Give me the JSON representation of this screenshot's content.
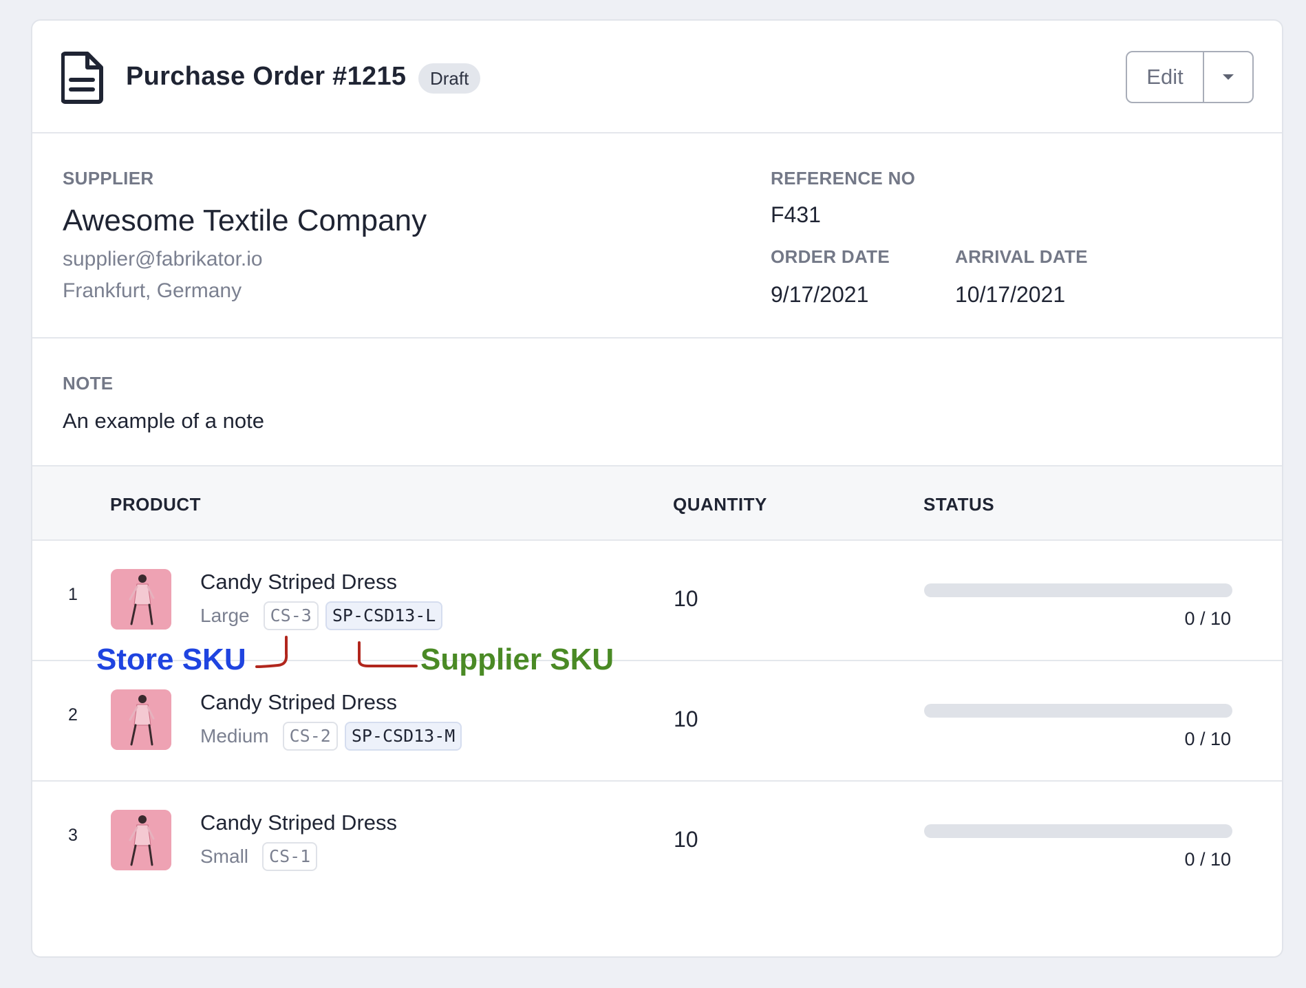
{
  "header": {
    "title": "Purchase Order #1215",
    "status_badge": "Draft",
    "edit_label": "Edit"
  },
  "supplier": {
    "label": "SUPPLIER",
    "name": "Awesome Textile Company",
    "email": "supplier@fabrikator.io",
    "location": "Frankfurt, Germany"
  },
  "reference": {
    "label": "REFERENCE NO",
    "value": "F431"
  },
  "order_date": {
    "label": "ORDER DATE",
    "value": "9/17/2021"
  },
  "arrival_date": {
    "label": "ARRIVAL DATE",
    "value": "10/17/2021"
  },
  "note": {
    "label": "NOTE",
    "text": "An example of a note"
  },
  "table": {
    "headers": {
      "product": "PRODUCT",
      "quantity": "QUANTITY",
      "status": "STATUS"
    },
    "rows": [
      {
        "num": "1",
        "name": "Candy Striped Dress",
        "variant": "Large",
        "store_sku": "CS-3",
        "supplier_sku": "SP-CSD13-L",
        "quantity": "10",
        "received": 0,
        "status_text": "0 / 10"
      },
      {
        "num": "2",
        "name": "Candy Striped Dress",
        "variant": "Medium",
        "store_sku": "CS-2",
        "supplier_sku": "SP-CSD13-M",
        "quantity": "10",
        "received": 0,
        "status_text": "0 / 10"
      },
      {
        "num": "3",
        "name": "Candy Striped Dress",
        "variant": "Small",
        "store_sku": "CS-1",
        "supplier_sku": "",
        "quantity": "10",
        "received": 0,
        "status_text": "0 / 10"
      }
    ]
  },
  "annotations": {
    "store_sku": "Store SKU",
    "supplier_sku": "Supplier SKU",
    "store_color": "#1f44e0",
    "supplier_color": "#4a8a25",
    "arrow_color": "#b1261d"
  },
  "icons": {
    "document": "document-icon",
    "caret": "caret-down-icon",
    "thumbnail": "product-thumbnail"
  },
  "colors": {
    "progress_track": "#dfe2e8",
    "badge_bg": "#e3e6ec"
  }
}
